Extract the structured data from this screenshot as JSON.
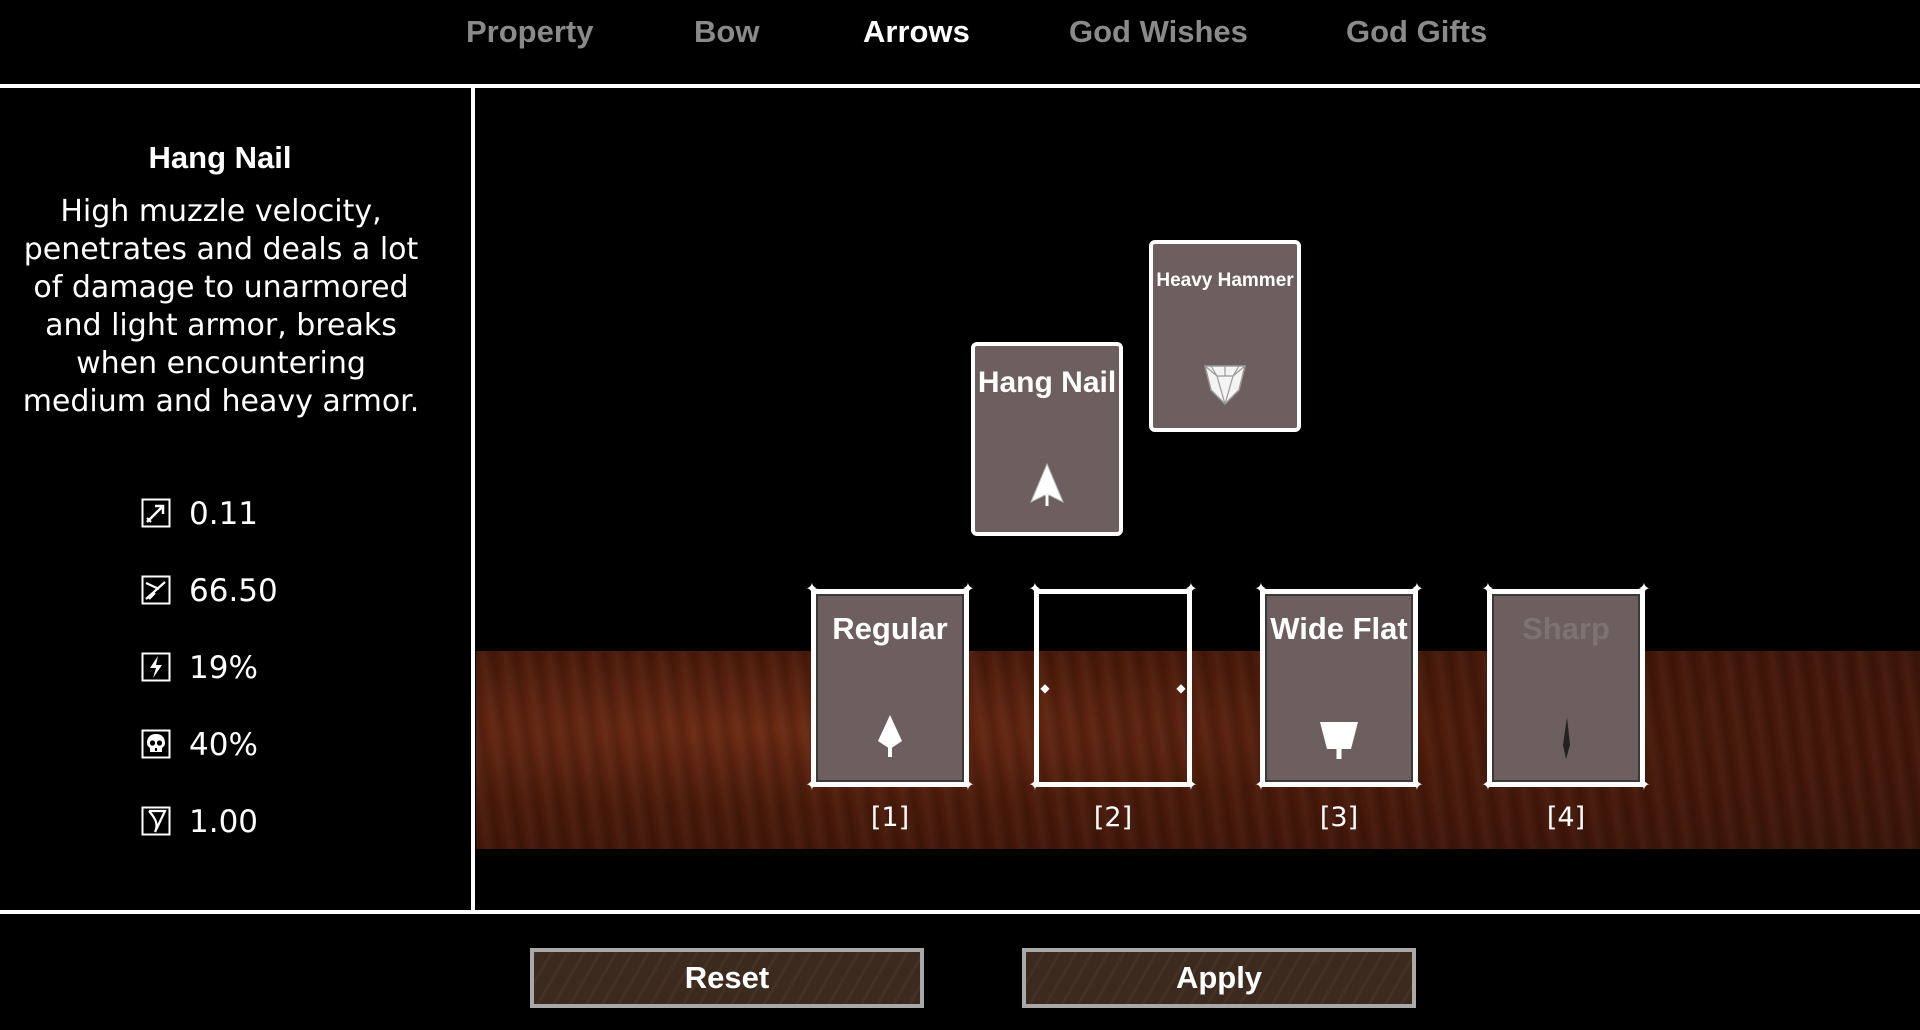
{
  "tabs": [
    {
      "label": "Property",
      "active": false
    },
    {
      "label": "Bow",
      "active": false
    },
    {
      "label": "Arrows",
      "active": true
    },
    {
      "label": "God Wishes",
      "active": false
    },
    {
      "label": "God Gifts",
      "active": false
    }
  ],
  "info": {
    "title": "Hang Nail",
    "description": "High muzzle velocity, penetrates and deals a lot of damage to unarmored and light armor, breaks when encountering medium and heavy armor.",
    "stats": [
      {
        "icon": "arrow-speed-icon",
        "value": "0.11"
      },
      {
        "icon": "arrow-damage-icon",
        "value": "66.50"
      },
      {
        "icon": "lightning-icon",
        "value": "19%"
      },
      {
        "icon": "skull-icon",
        "value": "40%"
      },
      {
        "icon": "bow-draw-icon",
        "value": "1.00"
      }
    ]
  },
  "choices": [
    {
      "label": "Hang Nail",
      "icon": "hang-nail-arrowhead-icon"
    },
    {
      "label": "Heavy Hammer",
      "icon": "heavy-hammer-arrowhead-icon"
    }
  ],
  "slots": [
    {
      "label": "Regular",
      "number": "[1]",
      "icon": "regular-arrowhead-icon",
      "state": "filled"
    },
    {
      "label": "",
      "number": "[2]",
      "icon": "",
      "state": "empty"
    },
    {
      "label": "Wide Flat",
      "number": "[3]",
      "icon": "wide-flat-arrowhead-icon",
      "state": "filled"
    },
    {
      "label": "Sharp",
      "number": "[4]",
      "icon": "sharp-arrowhead-icon",
      "state": "disabled"
    }
  ],
  "buttons": {
    "reset": "Reset",
    "apply": "Apply"
  },
  "colors": {
    "card": "#6d5e5f",
    "wood": "#4a1a0a",
    "tab_inactive": "#8a8a8a",
    "tab_active": "#ffffff"
  }
}
